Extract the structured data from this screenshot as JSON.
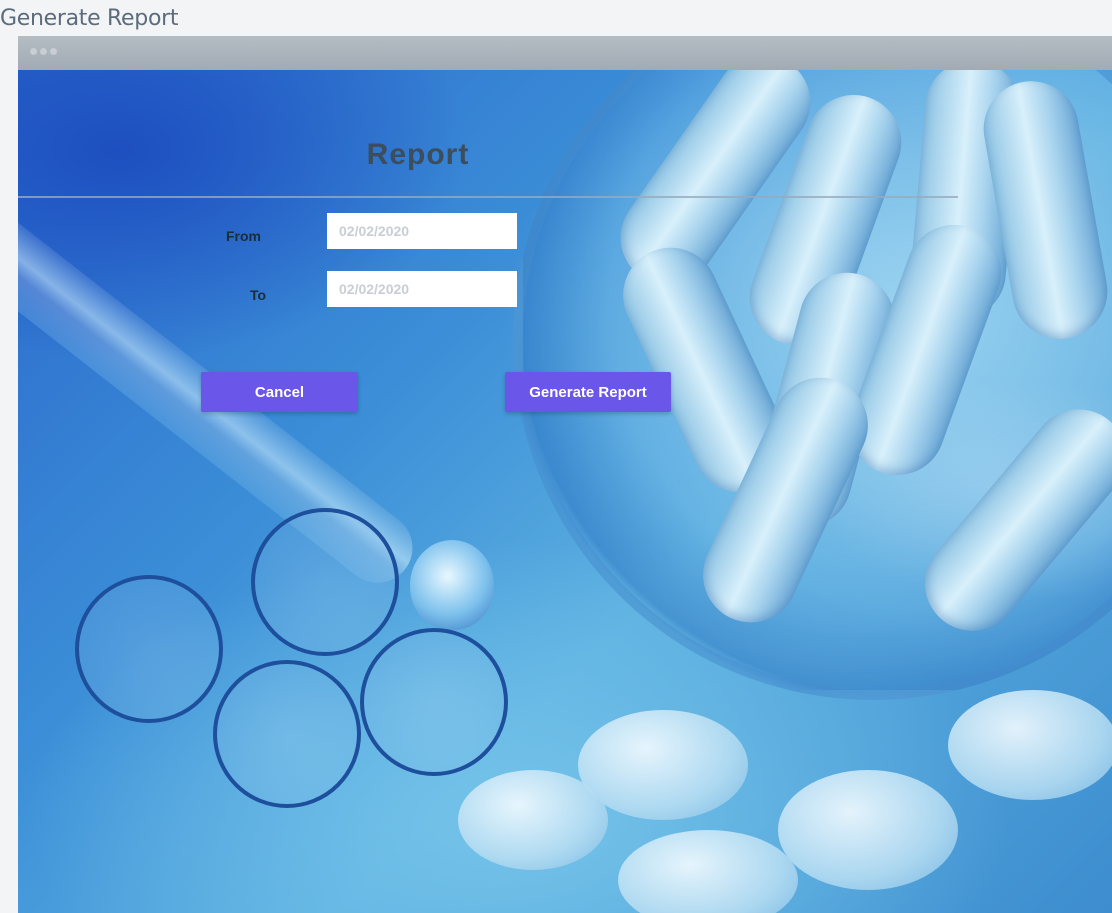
{
  "page": {
    "title": "Generate Report"
  },
  "window": {
    "controls": [
      "close-dot",
      "minimize-dot",
      "zoom-dot"
    ]
  },
  "form": {
    "title": "Report",
    "from": {
      "label": "From",
      "value": "02/02/2020"
    },
    "to": {
      "label": "To",
      "value": "02/02/2020"
    },
    "cancel_label": "Cancel",
    "generate_label": "Generate Report"
  },
  "colors": {
    "button": "#6a56e8",
    "title_text": "#3c4e5e",
    "field_text": "#c9ced4"
  }
}
